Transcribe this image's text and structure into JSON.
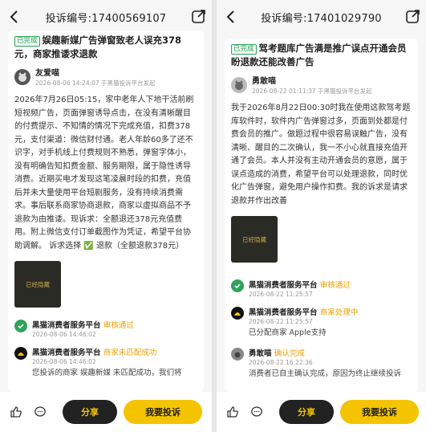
{
  "left": {
    "header_title": "投诉编号:17400569107",
    "badge": "已完成",
    "headline": "娱趣新媒广告弹窗致老人误充378元，商家推诿求退款",
    "author_name": "友爱喵",
    "author_meta": "2026-08-06 14:24:07 于黑猫投诉平台发起",
    "body": "2026年7月26日05:15，家中老年人下地干活前刷短视频广告，页面弹窗诱导点击，在没有清晰醒目的付费提示、不知情的情况下完成充值，扣费378元，支付渠道：微信财付通。老人年龄60多了还不识字，对手机线上付费规则不熟悉，弹窗字体小，没有明确告知扣费金额、服务期限，属于隐性诱导消费。近期买电才发现这笔凌晨时段的扣费，充值后并未大量使用平台短剧服务，没有持续消费需求。事后联系商家协商退款，商家以虚拟商品不予退款为由推诿。现诉求：全额退还378元充值费用。附上微信支付订单截图作为凭证，希望平台协助调解。 诉求选择 ✅ 退款（全额退款378元）",
    "thumb_label": "已经隐藏",
    "timeline": [
      {
        "name": "黑猫消费者服务平台",
        "status": "审核通过",
        "time": "2026-08-06 14:46:02",
        "text": ""
      },
      {
        "name": "黑猫消费者服务平台",
        "status": "商家未匹配成功",
        "time": "2026-08-06 14:46:02",
        "text": "您投诉的商家 娱趣新媒 未匹配成功，我们将"
      }
    ]
  },
  "right": {
    "header_title": "投诉编号:17401029790",
    "badge": "已完成",
    "headline": "驾考题库广告满是推广误点开通会员盼退款还能改善广告",
    "author_name": "勇敢喵",
    "author_meta": "2026-08-22 01:11:37 于黑猫投诉平台发起",
    "body": "我于2026年8月22日00:30时我在使用这款驾考题库软件时，软件内广告弹窗过多，页面到处都是付费会员的推广。做题过程中很容易误触广告，没有清晰、醒目的二次确认，我一不小心就直接充值开通了会员。本人并没有主动开通会员的意愿，属于误点造成的消费，希望平台可以处理退款，同时优化广告弹窗，避免用户操作扣费。我的诉求是请求退款并作出改善",
    "thumb_label": "已经隐藏",
    "timeline": [
      {
        "name": "黑猫消费者服务平台",
        "status": "审核通过",
        "time": "2026-08-22 11:25:57",
        "text": ""
      },
      {
        "name": "黑猫消费者服务平台",
        "status": "商家处理中",
        "time": "2026-08-22 11:25:57",
        "text": "已分配商家 Apple支持"
      },
      {
        "name": "勇敢喵",
        "status": "确认完成",
        "time": "2026-08-22 16:22:36",
        "text": "消费者已自主确认完成，原因为终止继续投诉"
      }
    ]
  },
  "bottom": {
    "share_label": "分享",
    "complain_label": "我要投诉"
  },
  "colors": {
    "accent": "#f5c400",
    "success": "#2fa35a",
    "status": "#e8a000"
  }
}
